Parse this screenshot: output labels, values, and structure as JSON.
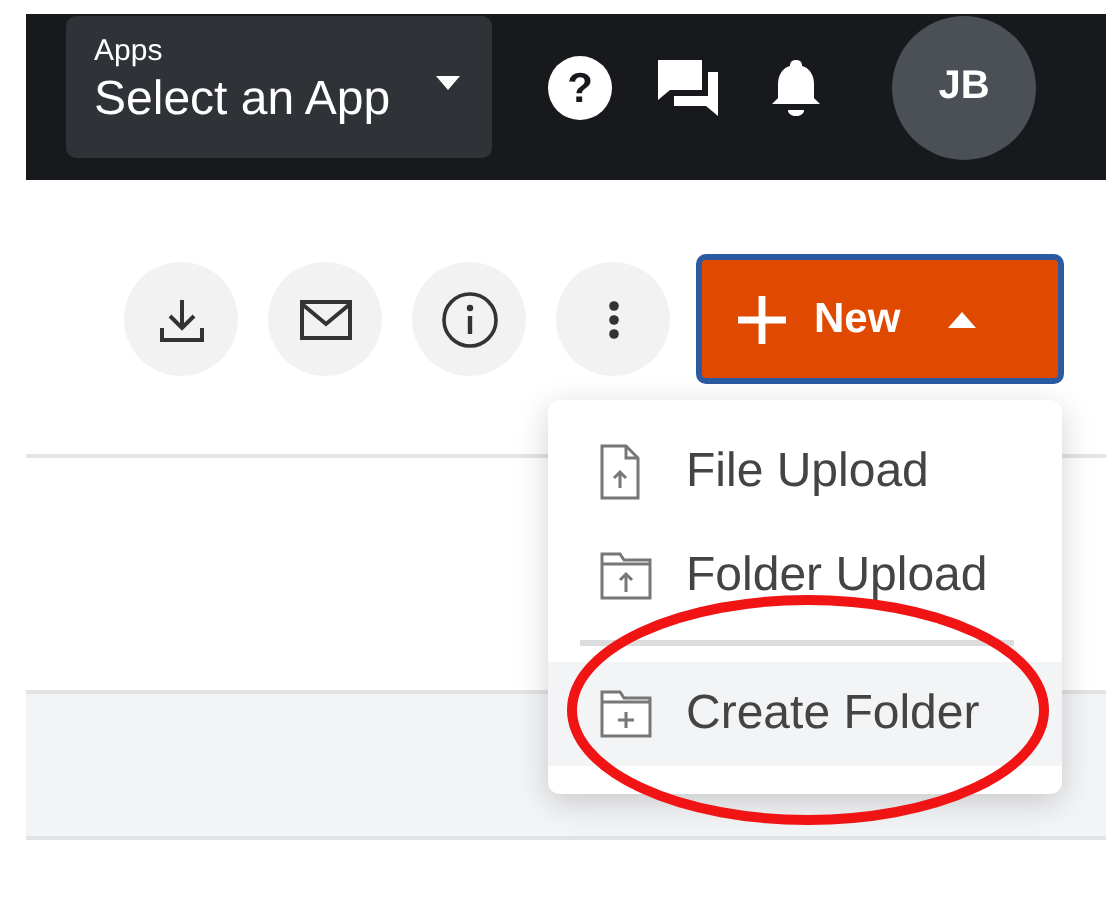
{
  "header": {
    "app_select": {
      "label": "Apps",
      "value": "Select an App"
    },
    "help_glyph": "?",
    "avatar": "JB"
  },
  "toolbar": {
    "new_button": {
      "label": "New",
      "expanded": true
    }
  },
  "new_menu": {
    "items": [
      {
        "kind": "file-upload",
        "label": "File Upload",
        "highlighted": false,
        "divider_above": false
      },
      {
        "kind": "folder-upload",
        "label": "Folder Upload",
        "highlighted": false,
        "divider_above": false
      },
      {
        "kind": "create-folder",
        "label": "Create Folder",
        "highlighted": true,
        "divider_above": true
      }
    ]
  },
  "annotation": {
    "kind": "ellipse"
  }
}
